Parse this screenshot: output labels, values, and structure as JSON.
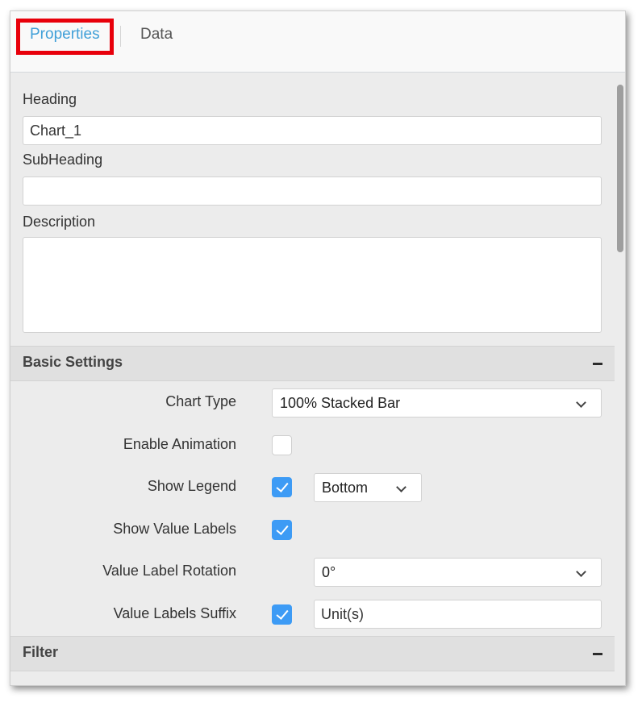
{
  "tabs": [
    {
      "label": "Properties",
      "active": true
    },
    {
      "label": "Data",
      "active": false
    }
  ],
  "fields": {
    "heading": {
      "label": "Heading",
      "value": "Chart_1"
    },
    "subheading": {
      "label": "SubHeading",
      "value": ""
    },
    "description": {
      "label": "Description",
      "value": ""
    }
  },
  "basic_settings": {
    "title": "Basic Settings",
    "collapse_icon": "minus-icon",
    "chart_type": {
      "label": "Chart Type",
      "value": "100% Stacked Bar"
    },
    "enable_animation": {
      "label": "Enable Animation",
      "checked": false
    },
    "show_legend": {
      "label": "Show Legend",
      "checked": true,
      "position": "Bottom"
    },
    "show_value_labels": {
      "label": "Show Value Labels",
      "checked": true
    },
    "value_label_rotation": {
      "label": "Value Label Rotation",
      "value": "0°"
    },
    "value_labels_suffix": {
      "label": "Value Labels Suffix",
      "checked": true,
      "value": "Unit(s)"
    }
  },
  "filter": {
    "title": "Filter",
    "collapse_icon": "minus-icon"
  },
  "colors": {
    "accent": "#41a0d8",
    "checkbox": "#3d9bf5",
    "highlight": "#e8000b"
  }
}
